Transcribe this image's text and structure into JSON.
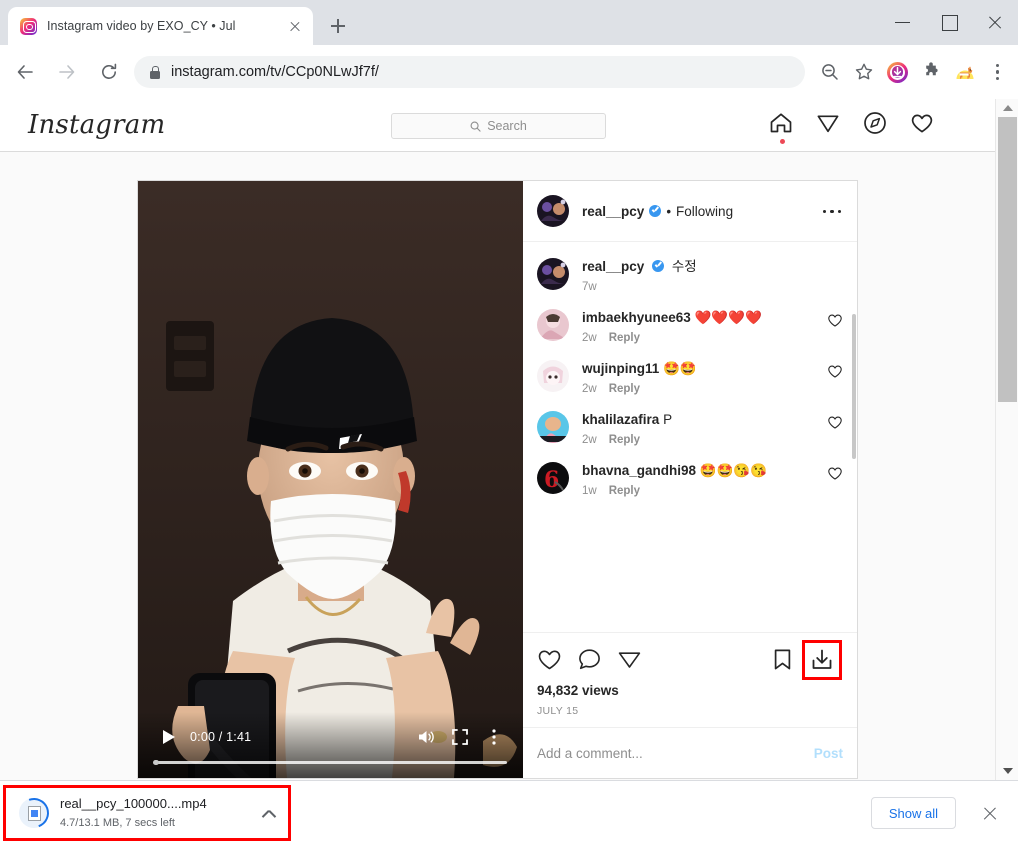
{
  "browser": {
    "tab": {
      "title": "Instagram video by EXO_CY • Jul",
      "favicon": "instagram-favicon",
      "close_icon": "close-icon"
    },
    "new_tab_icon": "plus-icon",
    "window_controls": {
      "minimize": "minimize-icon",
      "maximize": "maximize-icon",
      "close": "close-icon"
    },
    "nav": {
      "back_icon": "arrow-left-icon",
      "forward_icon": "arrow-right-icon",
      "reload_icon": "reload-icon"
    },
    "omnibox": {
      "lock_icon": "lock-icon",
      "url": "instagram.com/tv/CCp0NLwJf7f/",
      "zoom_icon": "zoom-out-icon",
      "bookmark_icon": "star-icon"
    },
    "extensions": [
      {
        "name": "instagram-downloader-extension-icon"
      },
      {
        "name": "puzzle-extensions-icon"
      },
      {
        "name": "corgi-extension-icon"
      }
    ],
    "menu_icon": "three-dot-menu-icon"
  },
  "instagram": {
    "logo": "Instagram",
    "search": {
      "placeholder": "Search",
      "icon": "search-icon"
    },
    "nav_icons": [
      {
        "name": "home-icon",
        "active": true
      },
      {
        "name": "messenger-send-icon",
        "active": false
      },
      {
        "name": "explore-compass-icon",
        "active": false
      },
      {
        "name": "heart-activity-icon",
        "active": false
      }
    ],
    "post": {
      "author": {
        "username": "real__pcy",
        "verified_icon": "verified-badge-icon",
        "separator": "•",
        "follow_state": "Following",
        "more_icon": "three-dot-more-icon"
      },
      "caption": {
        "username": "real__pcy",
        "text": "수정",
        "time": "7w"
      },
      "comments": [
        {
          "username": "imbaekhyunee63",
          "text": "❤️❤️❤️❤️",
          "time": "2w",
          "reply": "Reply",
          "like_icon": "heart-icon"
        },
        {
          "username": "wujinping11",
          "text": "🤩🤩",
          "time": "2w",
          "reply": "Reply",
          "like_icon": "heart-icon"
        },
        {
          "username": "khalilazafira",
          "text": "P",
          "time": "2w",
          "reply": "Reply",
          "like_icon": "heart-icon"
        },
        {
          "username": "bhavna_gandhi98",
          "text": "🤩🤩😘😘",
          "time": "1w",
          "reply": "Reply",
          "like_icon": "heart-icon"
        }
      ],
      "actions": {
        "like_icon": "heart-icon",
        "comment_icon": "comment-bubble-icon",
        "share_icon": "share-paper-plane-icon",
        "save_icon": "bookmark-icon",
        "download_icon": "download-arrow-icon"
      },
      "views": "94,832 views",
      "date": "JULY 15",
      "add_comment_placeholder": "Add a comment...",
      "post_button": "Post"
    },
    "video": {
      "play_icon": "play-icon",
      "time": "0:00 / 1:41",
      "volume_icon": "volume-icon",
      "fullscreen_icon": "fullscreen-icon",
      "options_icon": "video-options-icon",
      "progress_percent": 0
    }
  },
  "download_shelf": {
    "filename": "real__pcy_100000....mp4",
    "status": "4.7/13.1 MB, 7 secs left",
    "caret_icon": "chevron-up-icon",
    "show_all": "Show all",
    "close_icon": "close-icon"
  },
  "colors": {
    "highlight": "#ff0000",
    "accent_blue": "#1a73e8",
    "ig_blue": "#3897f0",
    "post_link": "#b2dffc"
  }
}
